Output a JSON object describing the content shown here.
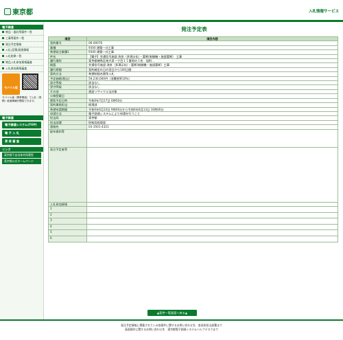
{
  "header": {
    "logo": "東京都",
    "service": "入札情報サービス"
  },
  "sidebar": {
    "section1": "電子調達",
    "items": [
      "物品・委託等案件一覧",
      "工事等案件一覧",
      "発注予定情報",
      "入札(見積)経過情報",
      "入札結果一覧",
      "物品入札参加資格審査",
      "入札参加資格審査"
    ],
    "mobile": "モバイル版",
    "mobile_caption": "モバイル版（携帯電話）で入札（見積）経過情報が閲覧できます。",
    "section2": "電子調達",
    "buttons": [
      "電子調達システム(TOP)",
      "電 子 入 札",
      "資 格 審 査"
    ],
    "section3": "リンク",
    "links": [
      "東京都下自治体共同運営",
      "東京都公式ホームページ"
    ]
  },
  "page": {
    "title": "発注予定表",
    "col_item": "項目",
    "col_content": "項目内容",
    "bottom_button": "▲案件一覧画面へ戻る▲"
  },
  "rows": [
    [
      "契約番号",
      "06-00076"
    ],
    [
      "業種",
      "9300 建築一式工事"
    ],
    [
      "希望発注業種1",
      "9300 建築一式工事"
    ],
    [
      "件名",
      "【電子】交通信号施設 改良（多現示化）・要断(制御機・施設要断） 工事"
    ],
    [
      "履行場所",
      "東京都練馬区南大泉一丁目１１番地の１先　旭町…"
    ],
    [
      "概要",
      "交通信号施設 改良（多現示化）・要断(制御機・施設要断）工事"
    ],
    [
      "履行期間",
      "契約確定の日の翌日から100日間"
    ],
    [
      "契約方法",
      "希望制指名競争入札"
    ],
    [
      "予定価格(税込)",
      "59,230,000円（消費税率10%）"
    ],
    [
      "発注等級",
      "該当なし"
    ],
    [
      "受付等級",
      "該当なし"
    ],
    [
      "その他",
      "建設リサイクル法対象"
    ],
    [
      "公報登載日",
      ""
    ],
    [
      "閲覧予定日時",
      "令和6年7月17日 0時50分"
    ],
    [
      "契約事務担当",
      "経理部"
    ],
    [
      "希望申請期間",
      "令和6年6月10日 9時00分から令和6年6月13日 16時00分"
    ],
    [
      "申請方法",
      "電子調達システムにより申請を行うこと"
    ],
    [
      "担当局",
      "東京都"
    ],
    [
      "担当部課",
      "財務局経理部"
    ],
    [
      "連絡先",
      "03-3501-4321"
    ],
    [
      "配布資料等",
      ""
    ],
    [
      "発注予定者等",
      ""
    ]
  ],
  "bidder_rows": [
    "入札参加資格",
    "1",
    "2",
    "3",
    "4",
    "5",
    "6"
  ],
  "footer": {
    "line1": "発注予定情報に掲載されている各案件に関するお問い合わせ先　各局所担当部署まで",
    "line2": "画面操作に関するお問い合わせ先　東京都電子調達システムヘルプデスクまで"
  }
}
